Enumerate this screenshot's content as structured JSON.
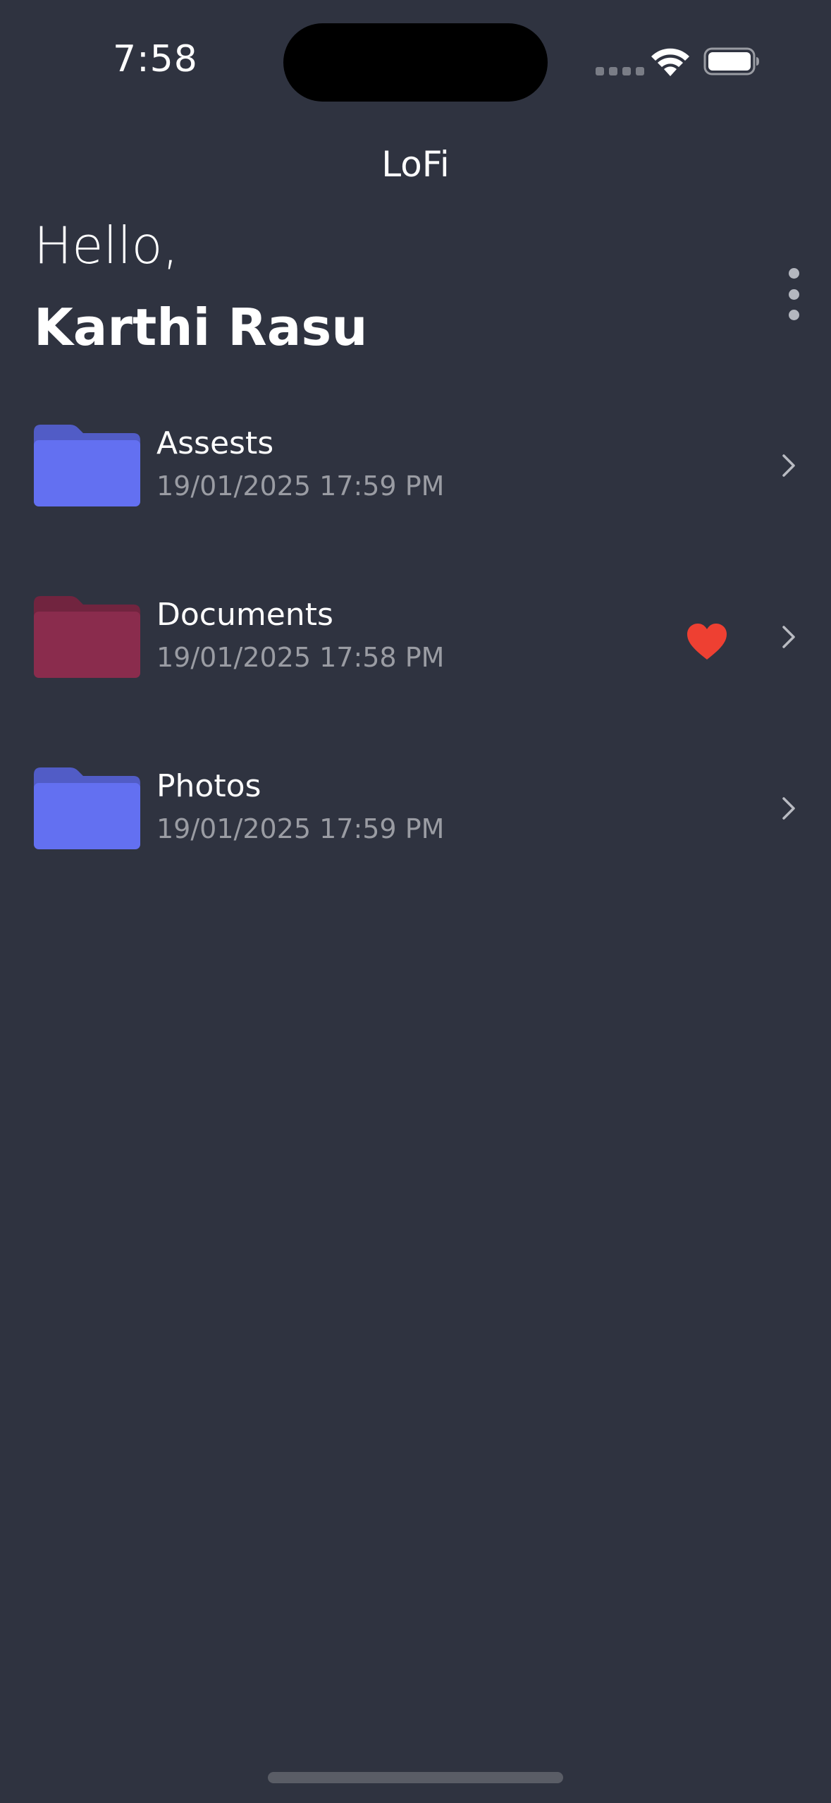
{
  "status_bar": {
    "time": "7:58"
  },
  "header": {
    "app_title": "LoFi"
  },
  "greeting": {
    "salutation": "Hello,",
    "user_name": "Karthi Rasu"
  },
  "folders": [
    {
      "name": "Assests",
      "date": "19/01/2025 17:59 PM",
      "color": "#6370f1",
      "favorite": false
    },
    {
      "name": "Documents",
      "date": "19/01/2025 17:58 PM",
      "color": "#8a2c4d",
      "favorite": true
    },
    {
      "name": "Photos",
      "date": "19/01/2025 17:59 PM",
      "color": "#6370f1",
      "favorite": false
    }
  ],
  "icons": {
    "folder": "folder-icon",
    "favorite": "heart-icon",
    "row_action": "chevron-right-icon",
    "more": "more-vertical-icon"
  },
  "colors": {
    "background": "#2f3340",
    "favorite": "#ee4032",
    "secondary_text": "#9a9ca3"
  }
}
